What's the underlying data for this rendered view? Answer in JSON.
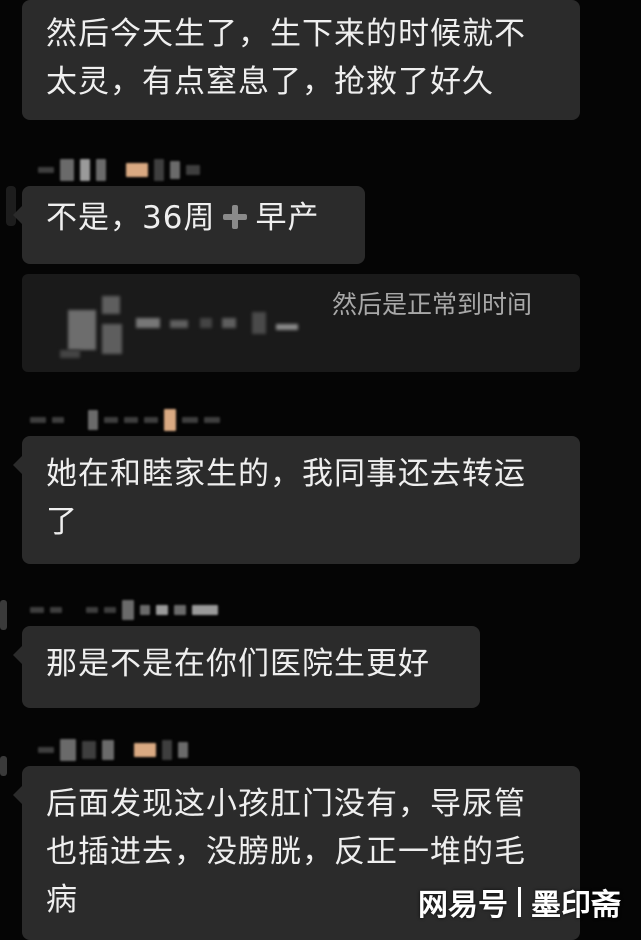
{
  "messages": [
    {
      "text_lines": [
        "然后今天生了，生下来的时候就不",
        "太灵，有点窒息了，抢救了好久"
      ]
    },
    {
      "text_before": "不是，36周",
      "icon": "plus-icon",
      "text_after": "早产"
    },
    {
      "quote_text": "然后是正常到时间"
    },
    {
      "text_lines": [
        "她在和睦家生的，我同事还去转运",
        "了"
      ]
    },
    {
      "text_lines": [
        "那是不是在你们医院生更好"
      ]
    },
    {
      "text_lines": [
        "后面发现这小孩肛门没有，导尿管",
        "也插进去，没膀胱，反正一堆的毛",
        "病"
      ]
    }
  ],
  "watermark": {
    "brand": "网易号",
    "author": "墨印斋"
  },
  "colors": {
    "background": "#050505",
    "bubble": "#2b2b2b",
    "text": "#efefef",
    "quote_text": "#a8a8a8"
  }
}
